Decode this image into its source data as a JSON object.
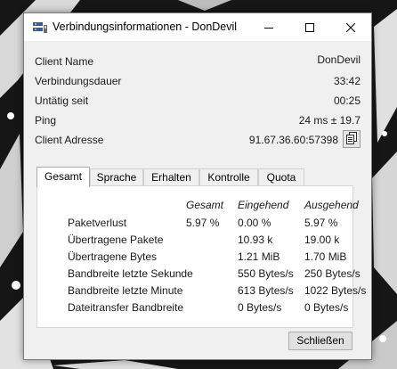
{
  "window": {
    "title": "Verbindungsinformationen - DonDevil"
  },
  "info": [
    {
      "label": "Client Name",
      "value": "DonDevil"
    },
    {
      "label": "Verbindungsdauer",
      "value": "33:42"
    },
    {
      "label": "Untätig seit",
      "value": "00:25"
    },
    {
      "label": "Ping",
      "value": "24 ms ± 19.7"
    },
    {
      "label": "Client Adresse",
      "value": "91.67.36.60:57398"
    }
  ],
  "tabs": [
    {
      "label": "Gesamt",
      "active": true
    },
    {
      "label": "Sprache",
      "active": false
    },
    {
      "label": "Erhalten",
      "active": false
    },
    {
      "label": "Kontrolle",
      "active": false
    },
    {
      "label": "Quota",
      "active": false
    }
  ],
  "stats": {
    "columns": [
      "Gesamt",
      "Eingehend",
      "Ausgehend"
    ],
    "rows": [
      {
        "label": "Paketverlust",
        "total": "5.97 %",
        "in": "0.00 %",
        "out": "5.97 %"
      },
      {
        "label": "Übertragene Pakete",
        "total": "",
        "in": "10.93 k",
        "out": "19.00 k"
      },
      {
        "label": "Übertragene Bytes",
        "total": "",
        "in": "1.21 MiB",
        "out": "1.70 MiB"
      },
      {
        "label": "Bandbreite letzte Sekunde",
        "total": "",
        "in": "550 Bytes/s",
        "out": "250 Bytes/s"
      },
      {
        "label": "Bandbreite letzte Minute",
        "total": "",
        "in": "613 Bytes/s",
        "out": "1022 Bytes/s"
      },
      {
        "label": "Dateitransfer Bandbreite",
        "total": "",
        "in": "0 Bytes/s",
        "out": "0 Bytes/s"
      }
    ]
  },
  "buttons": {
    "close_label": "Schließen"
  },
  "colors": {
    "window_bg": "#f0f0f0",
    "titlebar_bg": "#ffffff",
    "panel_bg": "#ffffff"
  },
  "icons": {
    "app": "server-icon",
    "copy": "copy-icon",
    "minimize": "minimize-icon",
    "maximize": "maximize-icon",
    "close": "close-icon"
  }
}
